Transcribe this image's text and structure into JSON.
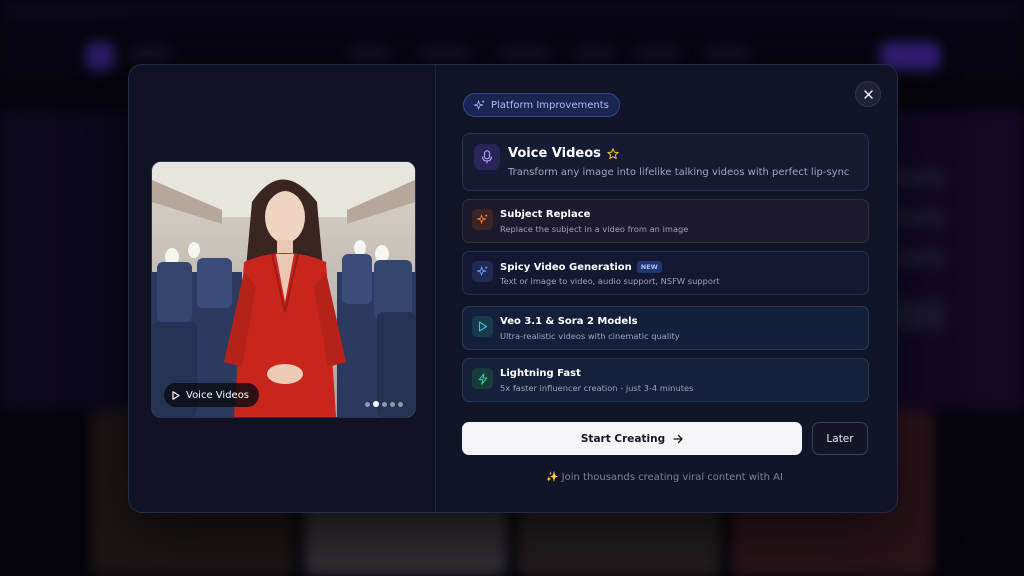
{
  "modal": {
    "badge_label": "Platform Improvements",
    "close_label": "×",
    "preview": {
      "chip_label": "Voice Videos",
      "dots_total": 5,
      "active_dot_index": 1
    },
    "hero": {
      "title": "Voice Videos",
      "subtitle": "Transform any image into lifelike talking videos with perfect lip-sync",
      "icon": "microphone-icon",
      "title_icon": "star-outline-icon"
    },
    "features": [
      {
        "title": "Subject Replace",
        "subtitle": "Replace the subject in a video from an image",
        "icon": "sparkles-icon",
        "accent": "#f07a3a",
        "tag": ""
      },
      {
        "title": "Spicy Video Generation",
        "subtitle": "Text or image to video, audio support, NSFW support",
        "icon": "sparkles-icon",
        "accent": "#5b8cff",
        "tag": "NEW"
      },
      {
        "title": "Veo 3.1 & Sora 2 Models",
        "subtitle": "Ultra-realistic videos with cinematic quality",
        "icon": "play-icon",
        "accent": "#2fb6d6",
        "tag": ""
      },
      {
        "title": "Lightning Fast",
        "subtitle": "5x faster influencer creation - just 3-4 minutes",
        "icon": "lightning-icon",
        "accent": "#2fc49a",
        "tag": ""
      }
    ],
    "primary_button": "Start Creating",
    "secondary_button": "Later",
    "footer_note": "✨ Join thousands creating viral content with AI"
  }
}
